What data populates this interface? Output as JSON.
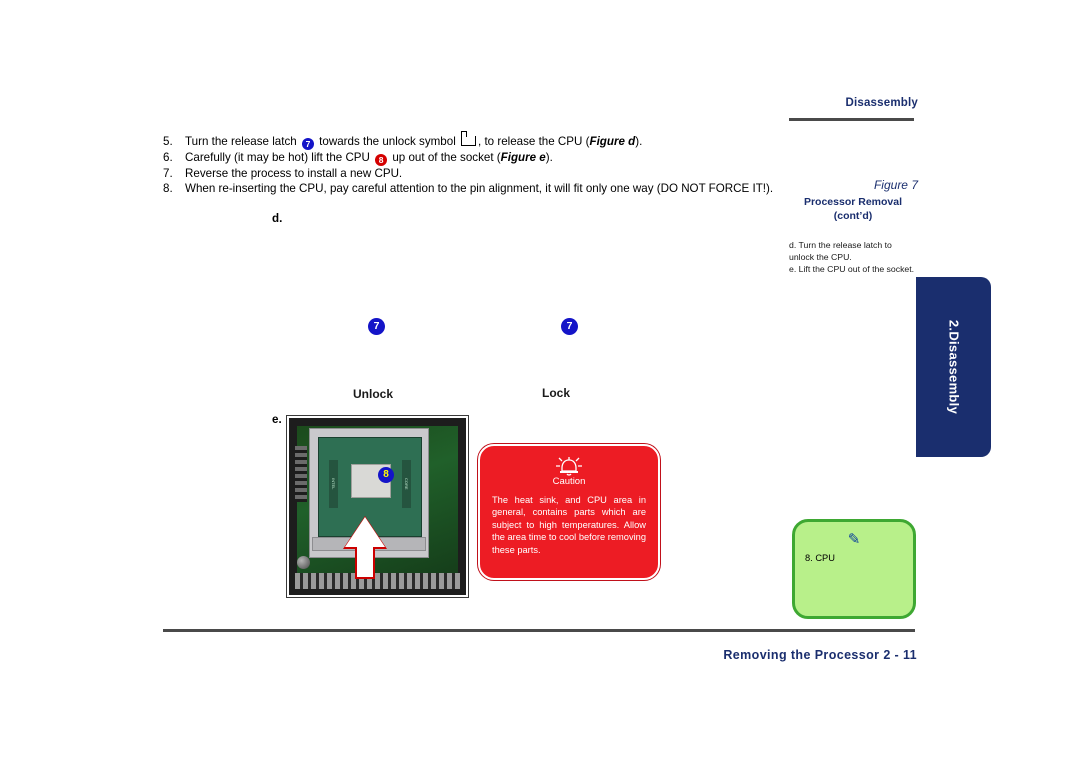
{
  "header": {
    "title": "Disassembly"
  },
  "steps": [
    {
      "num": "5.",
      "parts": [
        {
          "t": "text",
          "v": "Turn the release latch "
        },
        {
          "t": "badge-blue",
          "v": "7"
        },
        {
          "t": "text",
          "v": " towards the unlock symbol "
        },
        {
          "t": "icon",
          "v": "unlock-latch-icon"
        },
        {
          "t": "text",
          "v": ", to release the CPU ("
        },
        {
          "t": "bold-italic",
          "v": "Figure d"
        },
        {
          "t": "text",
          "v": ")."
        }
      ]
    },
    {
      "num": "6.",
      "parts": [
        {
          "t": "text",
          "v": "Carefully (it may be hot) lift the CPU "
        },
        {
          "t": "badge-red",
          "v": "8"
        },
        {
          "t": "text",
          "v": " up out of the socket ("
        },
        {
          "t": "bold-italic",
          "v": "Figure e"
        },
        {
          "t": "text",
          "v": ")."
        }
      ]
    },
    {
      "num": "7.",
      "parts": [
        {
          "t": "text",
          "v": "Reverse the process to install a new CPU."
        }
      ]
    },
    {
      "num": "8.",
      "parts": [
        {
          "t": "text",
          "v": "When re-inserting the CPU, pay careful attention to the pin alignment, it will fit only one way (DO NOT FORCE IT!)."
        }
      ]
    }
  ],
  "figure_labels": {
    "d": "d.",
    "e": "e.",
    "unlock": "Unlock",
    "lock": "Lock",
    "marker_left": "7",
    "marker_right": "7",
    "photo_badge": "8"
  },
  "caution": {
    "title": "Caution",
    "body": "The heat sink, and CPU area in general, contains parts which are subject to high temperatures. Allow the area time to cool before removing these parts.",
    "color": "#ed1c24"
  },
  "note": {
    "icon": "pencil-icon",
    "body": "8. CPU",
    "color": "#b8f08a",
    "border_color": "#3ea832"
  },
  "sidebar": {
    "figure_label": "Figure 7",
    "figure_title": "Processor Removal (cont’d)",
    "items": [
      {
        "lead": "d.",
        "text": "Turn the release latch to unlock the CPU."
      },
      {
        "lead": "e.",
        "text": "Lift the CPU out of the socket."
      }
    ]
  },
  "tab": {
    "label": "2.Disassembly",
    "color": "#1a2e6e"
  },
  "footer": {
    "text": "Removing the Processor 2 -  11"
  }
}
